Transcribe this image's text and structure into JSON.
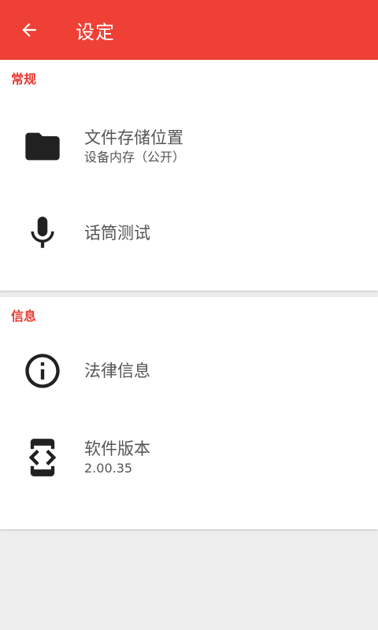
{
  "appbar": {
    "title": "设定",
    "back_icon": "arrow-left-icon"
  },
  "sections": [
    {
      "header": "常规",
      "items": [
        {
          "icon": "folder-icon",
          "title": "文件存储位置",
          "subtitle": "设备内存（公开）"
        },
        {
          "icon": "microphone-icon",
          "title": "话筒测试"
        }
      ]
    },
    {
      "header": "信息",
      "items": [
        {
          "icon": "info-icon",
          "title": "法律信息"
        },
        {
          "icon": "developer-mode-icon",
          "title": "软件版本",
          "subtitle": "2.00.35"
        }
      ]
    }
  ],
  "colors": {
    "primary": "#ef4036",
    "section_header": "#e53b30",
    "background": "#eeeeee"
  }
}
